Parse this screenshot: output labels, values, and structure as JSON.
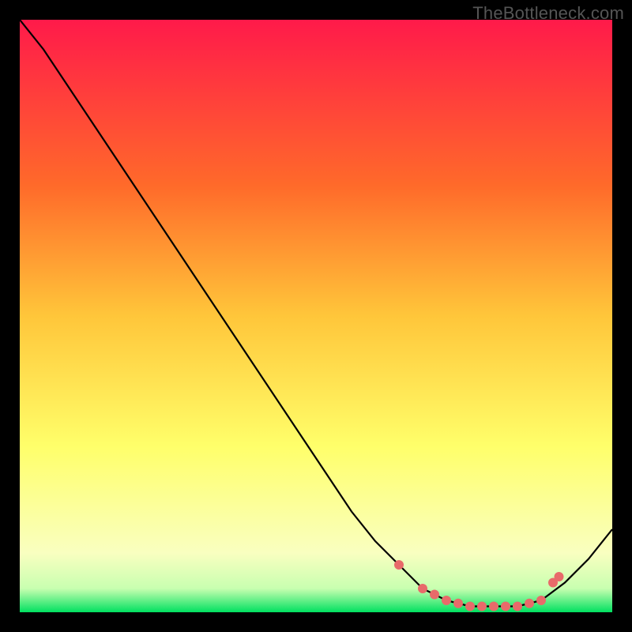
{
  "watermark": "TheBottleneck.com",
  "colors": {
    "gradient_top": "#ff1a4a",
    "gradient_mid_upper": "#ff8a2a",
    "gradient_mid": "#ffd23a",
    "gradient_lower": "#ffff6a",
    "gradient_bottom_band": "#f7ffb0",
    "gradient_green": "#00e060",
    "curve": "#000000",
    "marker": "#e86a6a",
    "frame": "#000000"
  },
  "chart_data": {
    "type": "line",
    "title": "",
    "xlabel": "",
    "ylabel": "",
    "xlim": [
      0,
      100
    ],
    "ylim": [
      0,
      100
    ],
    "series": [
      {
        "name": "bottleneck-curve",
        "x": [
          0,
          4,
          8,
          12,
          16,
          20,
          24,
          28,
          32,
          36,
          40,
          44,
          48,
          52,
          56,
          60,
          64,
          68,
          72,
          76,
          80,
          84,
          88,
          92,
          96,
          100
        ],
        "y": [
          100,
          95,
          89,
          83,
          77,
          71,
          65,
          59,
          53,
          47,
          41,
          35,
          29,
          23,
          17,
          12,
          8,
          4,
          2,
          1,
          1,
          1,
          2,
          5,
          9,
          14
        ]
      }
    ],
    "markers": {
      "name": "highlighted-points",
      "x": [
        64,
        68,
        70,
        72,
        74,
        76,
        78,
        80,
        82,
        84,
        86,
        88,
        90,
        91
      ],
      "y": [
        8,
        4,
        3,
        2,
        1.5,
        1,
        1,
        1,
        1,
        1,
        1.5,
        2,
        5,
        6
      ]
    }
  }
}
